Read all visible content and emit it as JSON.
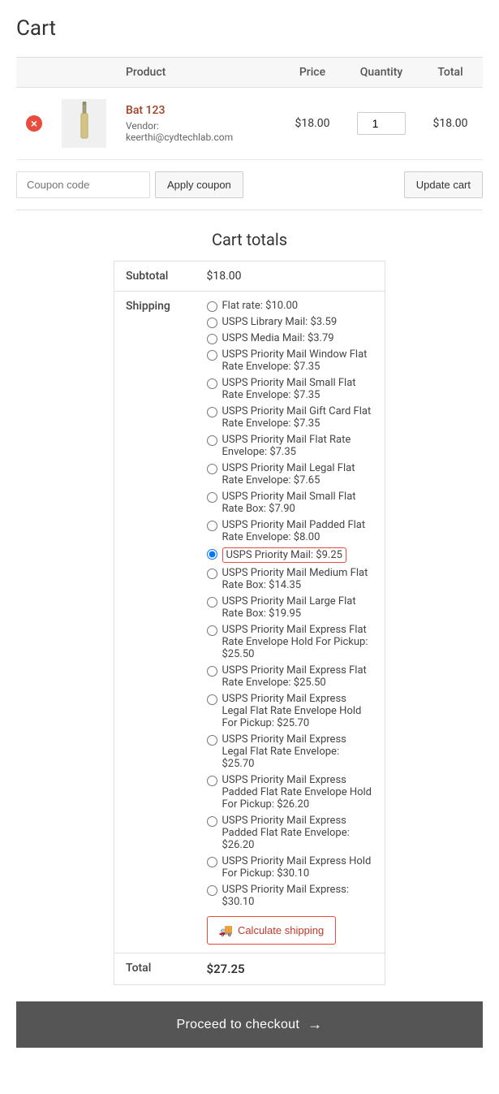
{
  "page": {
    "title": "Cart"
  },
  "table": {
    "headers": {
      "product": "Product",
      "price": "Price",
      "quantity": "Quantity",
      "total": "Total"
    }
  },
  "cart_items": [
    {
      "id": 1,
      "product_name": "Bat 123",
      "vendor_label": "Vendor:",
      "vendor_email": "keerthi@cydtechlab.com",
      "price": "$18.00",
      "quantity": 1,
      "total": "$18.00"
    }
  ],
  "coupon": {
    "placeholder": "Coupon code",
    "apply_label": "Apply coupon",
    "update_label": "Update cart"
  },
  "cart_totals": {
    "title": "Cart totals",
    "subtotal_label": "Subtotal",
    "subtotal_value": "$18.00",
    "shipping_label": "Shipping",
    "shipping_options": [
      {
        "id": "flat_rate",
        "label": "Flat rate: $10.00",
        "selected": false
      },
      {
        "id": "usps_library",
        "label": "USPS Library Mail: $3.59",
        "selected": false
      },
      {
        "id": "usps_media",
        "label": "USPS Media Mail: $3.79",
        "selected": false
      },
      {
        "id": "usps_pw_flat_env",
        "label": "USPS Priority Mail Window Flat Rate Envelope: $7.35",
        "selected": false
      },
      {
        "id": "usps_ps_flat_env",
        "label": "USPS Priority Mail Small Flat Rate Envelope: $7.35",
        "selected": false
      },
      {
        "id": "usps_pgc_flat_env",
        "label": "USPS Priority Mail Gift Card Flat Rate Envelope: $7.35",
        "selected": false
      },
      {
        "id": "usps_p_flat_env",
        "label": "USPS Priority Mail Flat Rate Envelope: $7.35",
        "selected": false
      },
      {
        "id": "usps_pl_flat_env",
        "label": "USPS Priority Mail Legal Flat Rate Envelope: $7.65",
        "selected": false
      },
      {
        "id": "usps_ps_flat_box",
        "label": "USPS Priority Mail Small Flat Rate Box: $7.90",
        "selected": false
      },
      {
        "id": "usps_pp_flat_env",
        "label": "USPS Priority Mail Padded Flat Rate Envelope: $8.00",
        "selected": false
      },
      {
        "id": "usps_p_mail",
        "label": "USPS Priority Mail: $9.25",
        "selected": true
      },
      {
        "id": "usps_pm_flat_box",
        "label": "USPS Priority Mail Medium Flat Rate Box: $14.35",
        "selected": false
      },
      {
        "id": "usps_pl_flat_box",
        "label": "USPS Priority Mail Large Flat Rate Box: $19.95",
        "selected": false
      },
      {
        "id": "usps_pe_flat_env_hold",
        "label": "USPS Priority Mail Express Flat Rate Envelope Hold For Pickup: $25.50",
        "selected": false
      },
      {
        "id": "usps_pe_flat_env",
        "label": "USPS Priority Mail Express Flat Rate Envelope: $25.50",
        "selected": false
      },
      {
        "id": "usps_pel_flat_env_hold",
        "label": "USPS Priority Mail Express Legal Flat Rate Envelope Hold For Pickup: $25.70",
        "selected": false
      },
      {
        "id": "usps_pel_flat_env",
        "label": "USPS Priority Mail Express Legal Flat Rate Envelope: $25.70",
        "selected": false
      },
      {
        "id": "usps_pep_flat_env_hold",
        "label": "USPS Priority Mail Express Padded Flat Rate Envelope Hold For Pickup: $26.20",
        "selected": false
      },
      {
        "id": "usps_pep_flat_env",
        "label": "USPS Priority Mail Express Padded Flat Rate Envelope: $26.20",
        "selected": false
      },
      {
        "id": "usps_pe_hold",
        "label": "USPS Priority Mail Express Hold For Pickup: $30.10",
        "selected": false
      },
      {
        "id": "usps_pe",
        "label": "USPS Priority Mail Express: $30.10",
        "selected": false
      }
    ],
    "calc_shipping_label": "Calculate shipping",
    "total_label": "Total",
    "total_value": "$27.25"
  },
  "checkout": {
    "button_label": "Proceed to checkout",
    "arrow": "→"
  },
  "icons": {
    "remove": "×",
    "truck": "🚚",
    "arrow_right": "→"
  }
}
